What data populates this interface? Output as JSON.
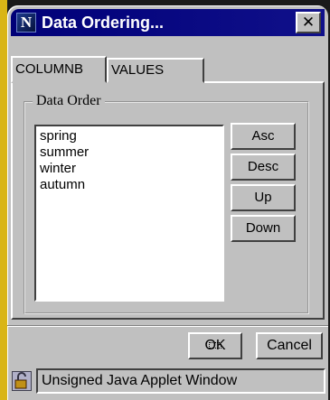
{
  "window": {
    "title": "Data Ordering...",
    "close_label": "✕",
    "logo_letter": "N"
  },
  "tabs": [
    {
      "label": "COLUMNB"
    },
    {
      "label": "VALUES"
    }
  ],
  "group": {
    "label": "Data Order",
    "items": [
      "spring",
      "summer",
      "winter",
      "autumn"
    ]
  },
  "side_buttons": {
    "asc": "Asc",
    "desc": "Desc",
    "up": "Up",
    "down": "Down"
  },
  "footer": {
    "ok": "OK",
    "cancel": "Cancel"
  },
  "statusbar": {
    "text": "Unsigned Java Applet Window"
  },
  "colors": {
    "titlebar": "#000078",
    "accent": "#d9b516"
  },
  "icons": {
    "logo": "netscape-n-icon",
    "close": "close-icon",
    "status": "padlock-icon"
  }
}
